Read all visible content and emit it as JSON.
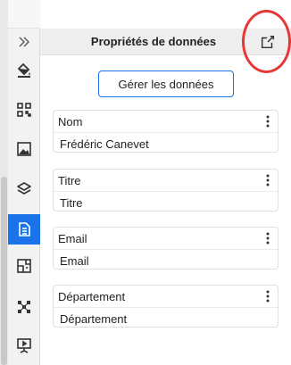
{
  "panel": {
    "title": "Propriétés de données",
    "manage_button": "Gérer les données",
    "accent": "#1a73e8",
    "annotation_color": "#e53935"
  },
  "rail": {
    "collapse_icon": "chevron-double-right-icon",
    "items": [
      {
        "icon": "paint-bucket-icon",
        "active": false
      },
      {
        "icon": "qr-code-icon",
        "active": false
      },
      {
        "icon": "image-icon",
        "active": false
      },
      {
        "icon": "layers-icon",
        "active": false
      },
      {
        "icon": "data-list-icon",
        "active": true
      },
      {
        "icon": "floor-plan-icon",
        "active": false
      },
      {
        "icon": "network-nodes-icon",
        "active": false
      },
      {
        "icon": "presentation-icon",
        "active": false
      }
    ]
  },
  "fields": [
    {
      "label": "Nom",
      "value": "Frédéric Canevet"
    },
    {
      "label": "Titre",
      "value": "Titre"
    },
    {
      "label": "Email",
      "value": "Email"
    },
    {
      "label": "Département",
      "value": "Département"
    }
  ]
}
